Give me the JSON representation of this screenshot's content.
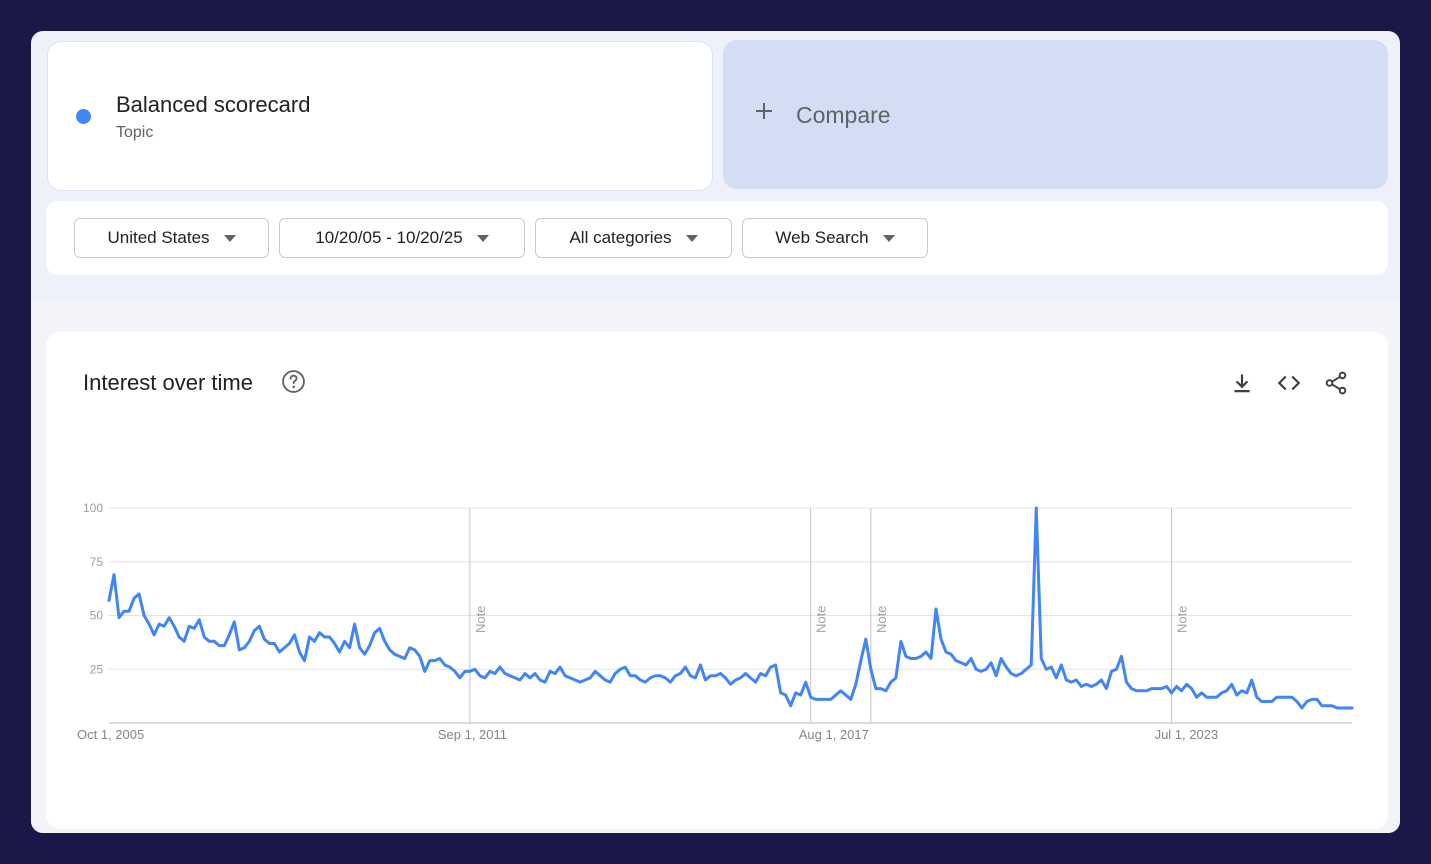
{
  "term": {
    "name": "Balanced scorecard",
    "type": "Topic",
    "color": "#4285f4"
  },
  "compare": {
    "label": "Compare",
    "icon": "plus-icon"
  },
  "filters": [
    {
      "label": "United States"
    },
    {
      "label": "10/20/05 - 10/20/25"
    },
    {
      "label": "All categories"
    },
    {
      "label": "Web Search"
    }
  ],
  "chart": {
    "title": "Interest over time",
    "help_icon": "help-circle-icon",
    "tools": [
      "download-icon",
      "embed-code-icon",
      "share-icon"
    ]
  },
  "chart_data": {
    "type": "line",
    "title": "Interest over time",
    "xlabel": "",
    "ylabel": "",
    "ylim": [
      0,
      100
    ],
    "yticks": [
      "100",
      "75",
      "50",
      "25"
    ],
    "xtick_labels": [
      "Oct 1, 2005",
      "Sep 1, 2011",
      "Aug 1, 2017",
      "Jul 1, 2023"
    ],
    "note_label": "Note",
    "series": [
      {
        "color": "#4285f4",
        "values": [
          57,
          69,
          49,
          52,
          52,
          58,
          60,
          50,
          46,
          41,
          46,
          45,
          49,
          45,
          40,
          38,
          45,
          44,
          48,
          40,
          38,
          38,
          36,
          36,
          41,
          47,
          34,
          35,
          38,
          43,
          45,
          39,
          37,
          37,
          33,
          35,
          37,
          41,
          33,
          29,
          40,
          38,
          42,
          40,
          40,
          37,
          33,
          38,
          35,
          46,
          35,
          32,
          36,
          42,
          44,
          38,
          34,
          32,
          31,
          30,
          35,
          34,
          31,
          24,
          29,
          29,
          30,
          27,
          26,
          24,
          21,
          24,
          24,
          25,
          22,
          21,
          24,
          23,
          26,
          23,
          22,
          21,
          20,
          23,
          21,
          23,
          20,
          19,
          24,
          23,
          26,
          22,
          21,
          20,
          19,
          20,
          21,
          24,
          22,
          20,
          19,
          23,
          25,
          26,
          22,
          22,
          20,
          19,
          21,
          22,
          22,
          21,
          19,
          22,
          23,
          26,
          22,
          21,
          27,
          20,
          22,
          22,
          23,
          21,
          18,
          20,
          21,
          23,
          21,
          19,
          23,
          22,
          26,
          27,
          14,
          13,
          8,
          14,
          13,
          19,
          12,
          11,
          11,
          11,
          11,
          13,
          15,
          13,
          11,
          18,
          29,
          39,
          25,
          16,
          16,
          15,
          19,
          21,
          38,
          31,
          30,
          30,
          31,
          33,
          30,
          53,
          39,
          33,
          32,
          29,
          28,
          27,
          30,
          25,
          24,
          25,
          28,
          22,
          30,
          26,
          23,
          22,
          23,
          25,
          27,
          100,
          30,
          25,
          26,
          21,
          27,
          20,
          19,
          20,
          17,
          18,
          17,
          18,
          20,
          16,
          24,
          25,
          31,
          19,
          16,
          15,
          15,
          15,
          16,
          16,
          16,
          17,
          14,
          17,
          15,
          18,
          16,
          12,
          14,
          12,
          12,
          12,
          14,
          15,
          18,
          13,
          15,
          14,
          20,
          12,
          10,
          10,
          10,
          12,
          12,
          12,
          12,
          10,
          7,
          10,
          11,
          11,
          8,
          8,
          8,
          7,
          7,
          7,
          7
        ]
      }
    ],
    "notes_at_index": [
      72,
      140,
      152,
      212
    ]
  }
}
